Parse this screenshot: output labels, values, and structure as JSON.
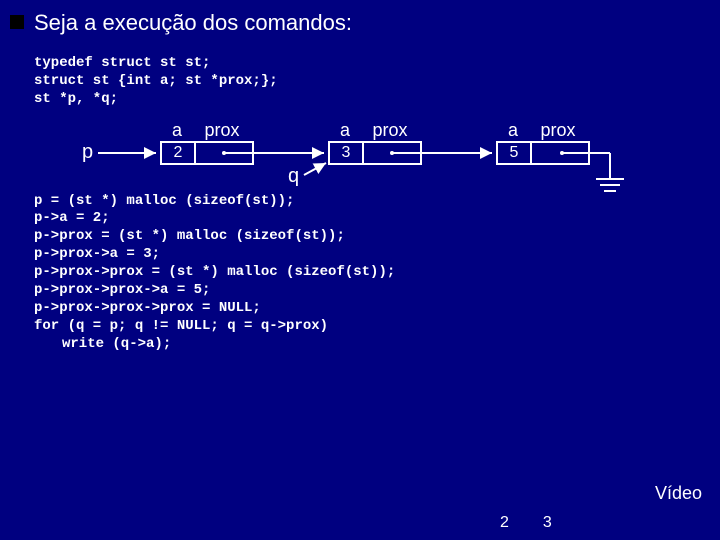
{
  "title": "Seja a execução dos comandos:",
  "code1": {
    "l1": "typedef struct st st;",
    "l2": "struct st {int a; st *prox;};",
    "l3": "st *p, *q;"
  },
  "diagram": {
    "p": "p",
    "q": "q",
    "colA": "a",
    "colP": "prox",
    "v1": "2",
    "v2": "3",
    "v3": "5"
  },
  "code2": {
    "l1": "p = (st *) malloc (sizeof(st));",
    "l2": "p->a = 2;",
    "l3": "p->prox = (st *) malloc (sizeof(st));",
    "l4": "p->prox->a = 3;",
    "l5": "p->prox->prox = (st *) malloc (sizeof(st));",
    "l6": "p->prox->prox->a = 5;",
    "l7": "p->prox->prox->prox = NULL;",
    "l8": "for (q = p; q != NULL; q = q->prox)",
    "l9": "write (q->a);"
  },
  "video": "Vídeo",
  "out": {
    "n1": "2",
    "n2": "3"
  }
}
